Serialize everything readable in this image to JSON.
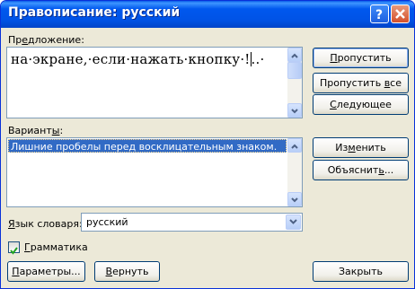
{
  "window": {
    "title": "Правописание: русский"
  },
  "sentence": {
    "label_pre": "Пр",
    "label_ul": "е",
    "label_post": "дложение:",
    "text_before_cursor": "на·экране,·если·нажать·кнопку·!",
    "text_after_cursor": "..·"
  },
  "suggestions": {
    "label_pre": "Вариант",
    "label_ul": "ы",
    "label_post": ":",
    "items": [
      "Лишние пробелы перед восклицательным знаком."
    ]
  },
  "buttons": {
    "skip": {
      "pre": "",
      "ul": "П",
      "post": "ропустить"
    },
    "skip_all": {
      "pre": "Пропустить ",
      "ul": "в",
      "post": "се"
    },
    "next": {
      "pre": "",
      "ul": "С",
      "post": "ледующее"
    },
    "change": {
      "pre": "Из",
      "ul": "м",
      "post": "енить"
    },
    "explain": {
      "pre": "Объяснит",
      "ul": "ь",
      "post": "..."
    },
    "options": {
      "pre": "",
      "ul": "П",
      "post": "араметры..."
    },
    "undo": {
      "pre": "",
      "ul": "В",
      "post": "ернуть"
    },
    "close": {
      "pre": "",
      "ul": "",
      "post": "Закрыть"
    }
  },
  "language": {
    "label_pre": "",
    "label_ul": "Я",
    "label_post": "зык словаря:",
    "value": "русский"
  },
  "grammar": {
    "checked": true,
    "label_pre": "",
    "label_ul": "Г",
    "label_post": "рамматика"
  }
}
